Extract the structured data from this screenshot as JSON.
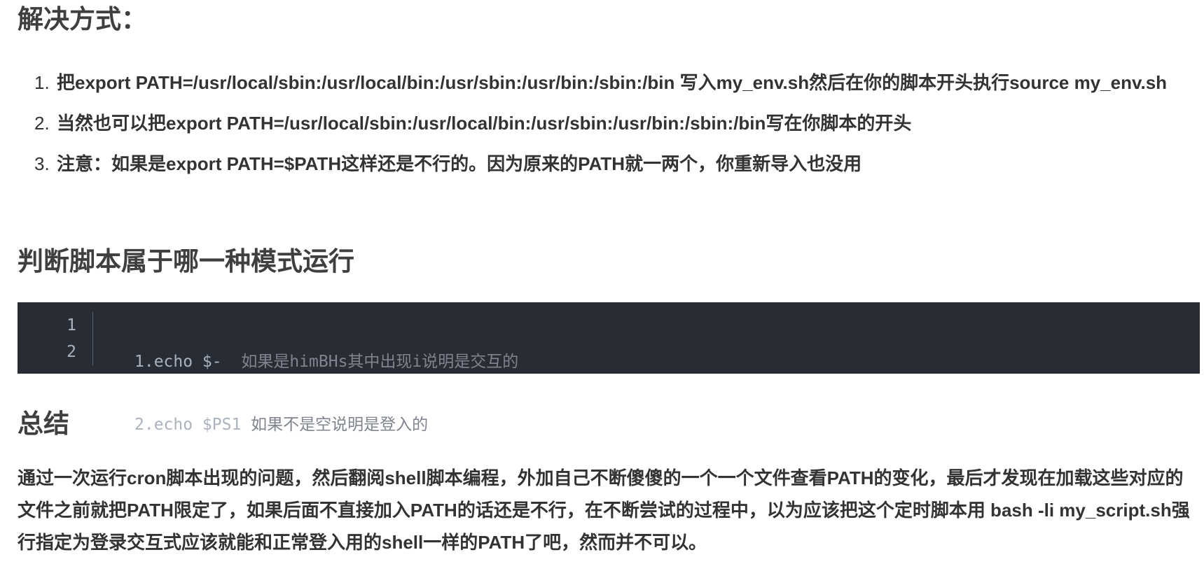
{
  "sections": {
    "solution_title": "解决方式：",
    "judge_title": "判断脚本属于哪一种模式运行",
    "summary_title": "总结"
  },
  "steps": [
    {
      "num": "1.",
      "text": "把export PATH=/usr/local/sbin:/usr/local/bin:/usr/sbin:/usr/bin:/sbin:/bin 写入my_env.sh然后在你的脚本开头执行source my_env.sh"
    },
    {
      "num": "2.",
      "text": "当然也可以把export PATH=/usr/local/sbin:/usr/local/bin:/usr/sbin:/usr/bin:/sbin:/bin写在你脚本的开头"
    },
    {
      "num": "3.",
      "text": "注意：如果是export PATH=$PATH这样还是不行的。因为原来的PATH就一两个，你重新导入也没用"
    }
  ],
  "code": {
    "line_numbers": [
      "1",
      "2"
    ],
    "lines": [
      {
        "cmd": "1.echo $-  ",
        "comment": "如果是himBHs其中出现i说明是交互的"
      },
      {
        "cmd": "2.echo $PS1 ",
        "comment": "如果不是空说明是登入的"
      }
    ]
  },
  "summary": {
    "text": "通过一次运行cron脚本出现的问题，然后翻阅shell脚本编程，外加自己不断傻傻的一个一个文件查看PATH的变化，最后才发现在加载这些对应的文件之前就把PATH限定了，如果后面不直接加入PATH的话还是不行，在不断尝试的过程中，以为应该把这个定时脚本用 bash -li my_script.sh强行指定为登录交互式应该就能和正常登入用的shell一样的PATH了吧，然而并不可以。"
  }
}
